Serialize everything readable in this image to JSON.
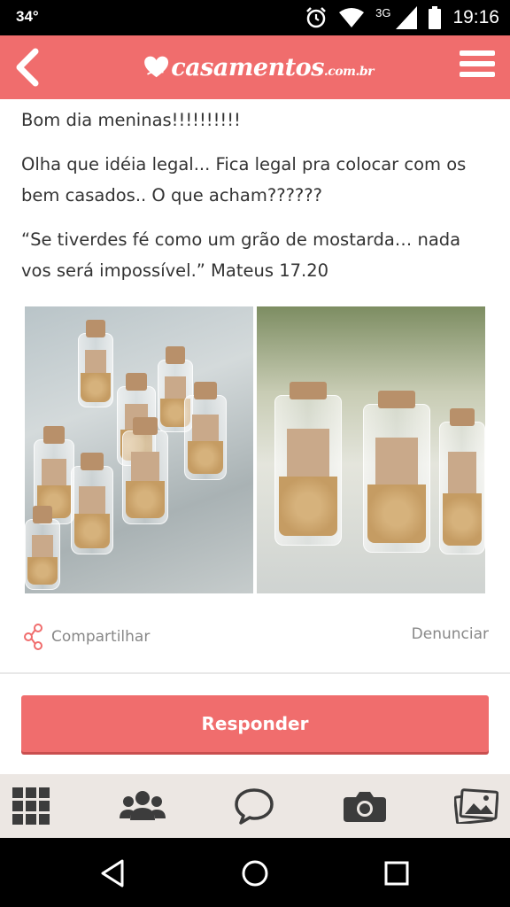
{
  "status_bar": {
    "temperature": "34°",
    "network": "3G",
    "time": "19:16",
    "icons": [
      "alarm-icon",
      "wifi-icon",
      "signal-icon",
      "battery-icon"
    ]
  },
  "header": {
    "logo_text": "casamentos",
    "logo_suffix": ".com.br",
    "back_icon": "back-arrow-icon",
    "menu_icon": "hamburger-menu-icon",
    "background_color": "#f06d6d"
  },
  "post": {
    "paragraphs": [
      "Bom dia meninas!!!!!!!!!!",
      "Olha que idéia legal... Fica legal pra colocar com os bem casados.. O que acham??????",
      "“Se tiverdes fé como um grão de mostarda… nada vos será impossível.” Mateus 17.20"
    ]
  },
  "photos": [
    {
      "name": "mustard-seed-jars-photo-1"
    },
    {
      "name": "mustard-seed-jars-photo-2"
    }
  ],
  "actions": {
    "share_label": "Compartilhar",
    "report_label": "Denunciar"
  },
  "reply": {
    "label": "Responder"
  },
  "bottom_nav": {
    "items": [
      "grid-icon",
      "community-icon",
      "chat-icon",
      "camera-icon",
      "gallery-icon"
    ]
  },
  "android_nav": {
    "items": [
      "back-icon",
      "home-icon",
      "recents-icon"
    ]
  }
}
